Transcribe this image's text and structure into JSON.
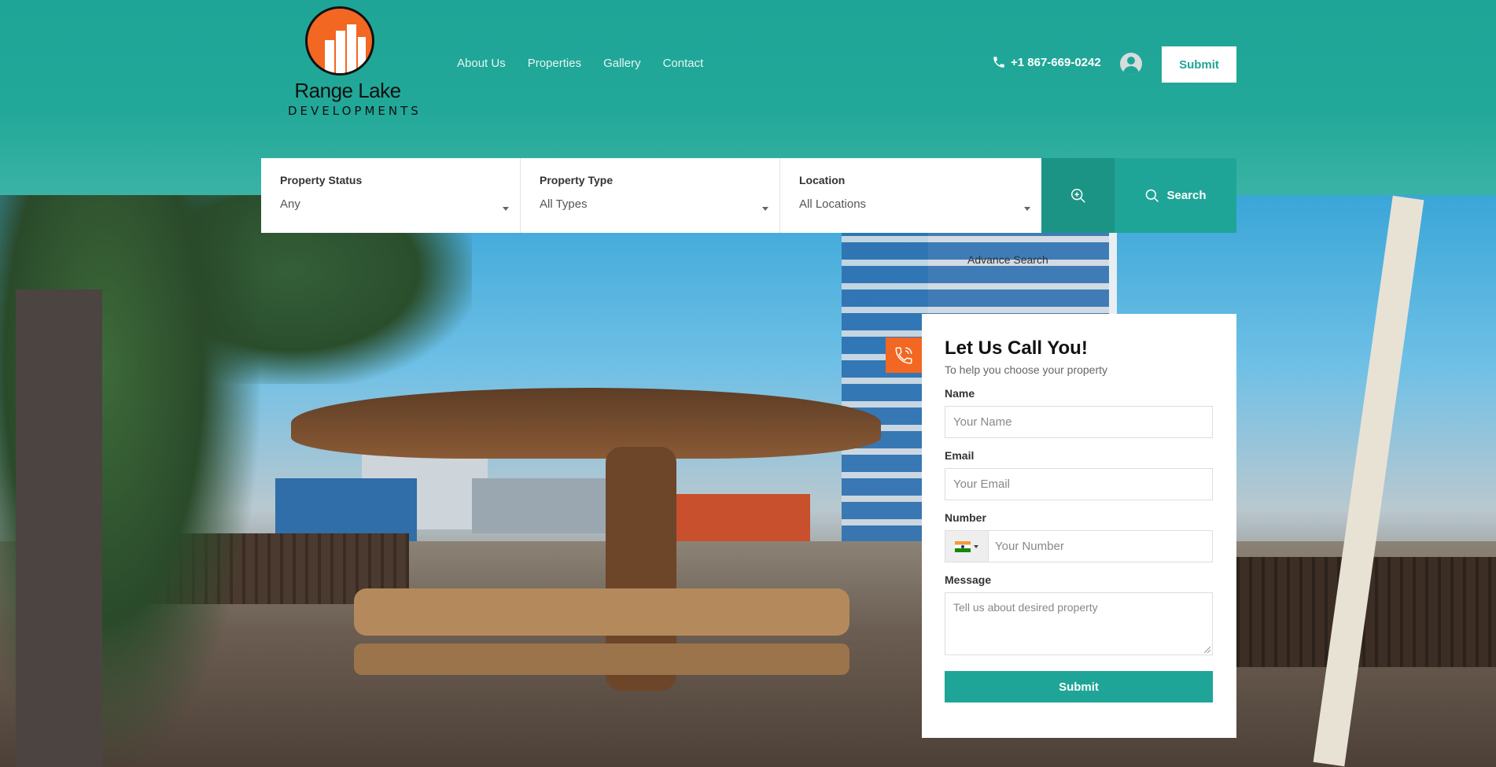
{
  "logo": {
    "line1": "Range Lake",
    "line2": "DEVELOPMENTS",
    "icon": "building-logo-icon"
  },
  "nav": {
    "items": [
      {
        "label": "About Us"
      },
      {
        "label": "Properties"
      },
      {
        "label": "Gallery"
      },
      {
        "label": "Contact"
      }
    ]
  },
  "header": {
    "phone": "+1 867-669-0242",
    "submit_label": "Submit"
  },
  "search": {
    "status": {
      "label": "Property Status",
      "value": "Any"
    },
    "type": {
      "label": "Property Type",
      "value": "All Types"
    },
    "location": {
      "label": "Location",
      "value": "All Locations"
    },
    "button_label": "Search",
    "advanced_link": "Advance Search"
  },
  "callform": {
    "title": "Let Us Call You!",
    "subtitle": "To help you choose your property",
    "name_label": "Name",
    "name_placeholder": "Your Name",
    "email_label": "Email",
    "email_placeholder": "Your Email",
    "number_label": "Number",
    "number_placeholder": "Your Number",
    "message_label": "Message",
    "message_placeholder": "Tell us about desired property",
    "submit_label": "Submit"
  },
  "colors": {
    "brand_teal": "#1fa597",
    "accent_orange": "#f26722"
  }
}
